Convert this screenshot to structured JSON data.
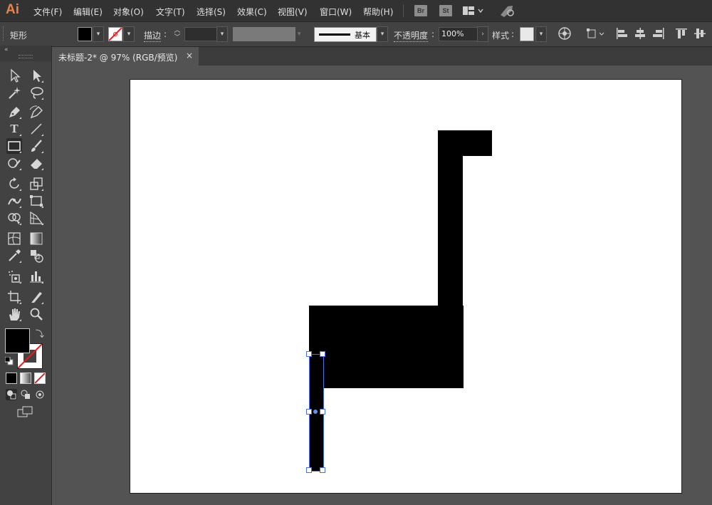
{
  "app": {
    "logo": "Ai"
  },
  "menu": {
    "items": [
      "文件(F)",
      "编辑(E)",
      "对象(O)",
      "文字(T)",
      "选择(S)",
      "效果(C)",
      "视图(V)",
      "窗口(W)",
      "帮助(H)"
    ],
    "bridge": "Br",
    "stock": "St"
  },
  "control": {
    "tool_name": "矩形",
    "stroke_label": "描边",
    "stroke_style": "基本",
    "opacity_label": "不透明度",
    "opacity_value": "100%",
    "style_label": "样式",
    "colors": {
      "fill": "#000000",
      "stroke": "none"
    }
  },
  "document": {
    "tab_title": "未标题-2* @ 97% (RGB/预览)",
    "close_glyph": "×"
  },
  "toolbar": {
    "tools": [
      "selection-tool",
      "direct-selection-tool",
      "magic-wand-tool",
      "lasso-tool",
      "pen-tool",
      "curvature-tool",
      "type-tool",
      "line-segment-tool",
      "rectangle-tool",
      "paintbrush-tool",
      "shaper-tool",
      "eraser-tool",
      "rotate-tool",
      "scale-tool",
      "width-tool",
      "free-transform-tool",
      "shape-builder-tool",
      "perspective-grid-tool",
      "mesh-tool",
      "gradient-tool",
      "eyedropper-tool",
      "blend-tool",
      "symbol-sprayer-tool",
      "column-graph-tool",
      "artboard-tool",
      "slice-tool",
      "hand-tool",
      "zoom-tool"
    ],
    "active_tool": "rectangle-tool",
    "fill_color": "#000000"
  }
}
